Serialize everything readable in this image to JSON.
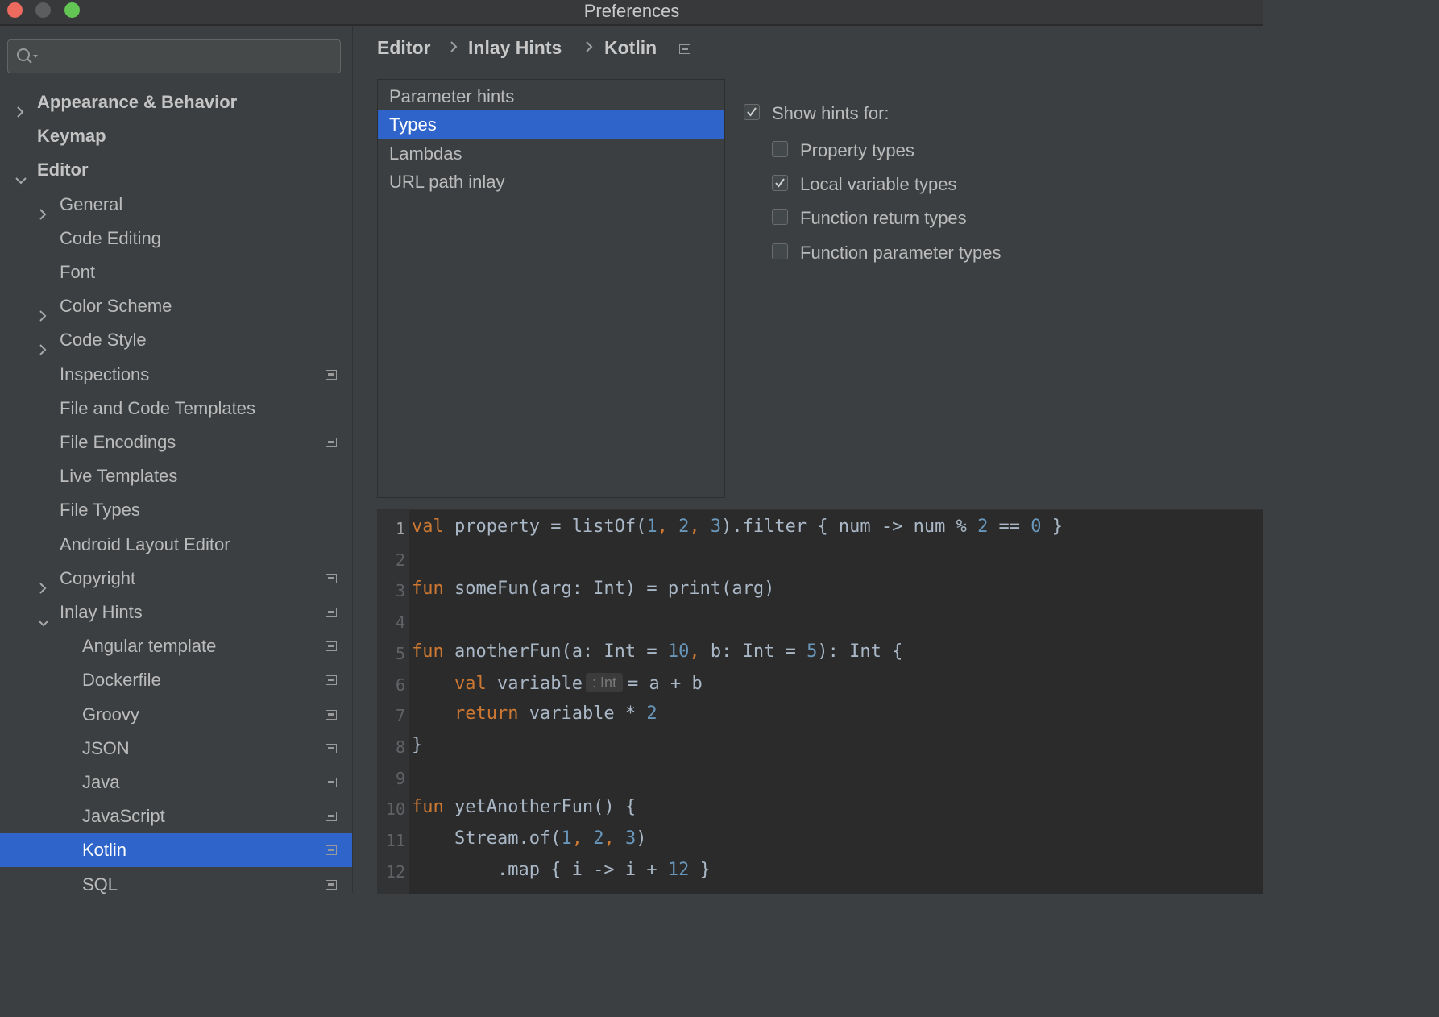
{
  "window": {
    "title": "Preferences"
  },
  "search": {
    "placeholder": "",
    "value": ""
  },
  "sidebar": {
    "items": [
      {
        "label": "Appearance & Behavior",
        "level": 0,
        "bold": true,
        "expander": "collapsed",
        "project_icon": false,
        "selected": false
      },
      {
        "label": "Keymap",
        "level": 0,
        "bold": true,
        "expander": "none",
        "project_icon": false,
        "selected": false
      },
      {
        "label": "Editor",
        "level": 0,
        "bold": true,
        "expander": "expanded",
        "project_icon": false,
        "selected": false
      },
      {
        "label": "General",
        "level": 1,
        "bold": false,
        "expander": "collapsed",
        "project_icon": false,
        "selected": false
      },
      {
        "label": "Code Editing",
        "level": 1,
        "bold": false,
        "expander": "none",
        "project_icon": false,
        "selected": false
      },
      {
        "label": "Font",
        "level": 1,
        "bold": false,
        "expander": "none",
        "project_icon": false,
        "selected": false
      },
      {
        "label": "Color Scheme",
        "level": 1,
        "bold": false,
        "expander": "collapsed",
        "project_icon": false,
        "selected": false
      },
      {
        "label": "Code Style",
        "level": 1,
        "bold": false,
        "expander": "collapsed",
        "project_icon": false,
        "selected": false
      },
      {
        "label": "Inspections",
        "level": 1,
        "bold": false,
        "expander": "none",
        "project_icon": true,
        "selected": false
      },
      {
        "label": "File and Code Templates",
        "level": 1,
        "bold": false,
        "expander": "none",
        "project_icon": false,
        "selected": false
      },
      {
        "label": "File Encodings",
        "level": 1,
        "bold": false,
        "expander": "none",
        "project_icon": true,
        "selected": false
      },
      {
        "label": "Live Templates",
        "level": 1,
        "bold": false,
        "expander": "none",
        "project_icon": false,
        "selected": false
      },
      {
        "label": "File Types",
        "level": 1,
        "bold": false,
        "expander": "none",
        "project_icon": false,
        "selected": false
      },
      {
        "label": "Android Layout Editor",
        "level": 1,
        "bold": false,
        "expander": "none",
        "project_icon": false,
        "selected": false
      },
      {
        "label": "Copyright",
        "level": 1,
        "bold": false,
        "expander": "collapsed",
        "project_icon": true,
        "selected": false
      },
      {
        "label": "Inlay Hints",
        "level": 1,
        "bold": false,
        "expander": "expanded",
        "project_icon": true,
        "selected": false
      },
      {
        "label": "Angular template",
        "level": 2,
        "bold": false,
        "expander": "none",
        "project_icon": true,
        "selected": false
      },
      {
        "label": "Dockerfile",
        "level": 2,
        "bold": false,
        "expander": "none",
        "project_icon": true,
        "selected": false
      },
      {
        "label": "Groovy",
        "level": 2,
        "bold": false,
        "expander": "none",
        "project_icon": true,
        "selected": false
      },
      {
        "label": "JSON",
        "level": 2,
        "bold": false,
        "expander": "none",
        "project_icon": true,
        "selected": false
      },
      {
        "label": "Java",
        "level": 2,
        "bold": false,
        "expander": "none",
        "project_icon": true,
        "selected": false
      },
      {
        "label": "JavaScript",
        "level": 2,
        "bold": false,
        "expander": "none",
        "project_icon": true,
        "selected": false
      },
      {
        "label": "Kotlin",
        "level": 2,
        "bold": false,
        "expander": "none",
        "project_icon": true,
        "selected": true
      },
      {
        "label": "SQL",
        "level": 2,
        "bold": false,
        "expander": "none",
        "project_icon": true,
        "selected": false
      }
    ]
  },
  "breadcrumb": [
    "Editor",
    "Inlay Hints",
    "Kotlin"
  ],
  "hint_categories": {
    "items": [
      "Parameter hints",
      "Types",
      "Lambdas",
      "URL path inlay"
    ],
    "selected_index": 1
  },
  "options": {
    "master": {
      "label": "Show hints for:",
      "checked": true
    },
    "items": [
      {
        "label": "Property types",
        "checked": false
      },
      {
        "label": "Local variable types",
        "checked": true
      },
      {
        "label": "Function return types",
        "checked": false
      },
      {
        "label": "Function parameter types",
        "checked": false
      }
    ]
  },
  "code_preview": {
    "current_line": 1,
    "lines": [
      {
        "n": "1",
        "tokens": [
          [
            "kw",
            "val"
          ],
          [
            "t",
            " property = listOf("
          ],
          [
            "num",
            "1"
          ],
          [
            "kw",
            ", "
          ],
          [
            "num",
            "2"
          ],
          [
            "kw",
            ", "
          ],
          [
            "num",
            "3"
          ],
          [
            "t",
            ").filter { num -> num % "
          ],
          [
            "num",
            "2"
          ],
          [
            "t",
            " == "
          ],
          [
            "num",
            "0"
          ],
          [
            "t",
            " }"
          ]
        ]
      },
      {
        "n": "2",
        "tokens": []
      },
      {
        "n": "3",
        "tokens": [
          [
            "kw",
            "fun"
          ],
          [
            "t",
            " someFun(arg: Int) = print(arg)"
          ]
        ]
      },
      {
        "n": "4",
        "tokens": []
      },
      {
        "n": "5",
        "tokens": [
          [
            "kw",
            "fun"
          ],
          [
            "t",
            " anotherFun(a: Int = "
          ],
          [
            "num",
            "10"
          ],
          [
            "kw",
            ", "
          ],
          [
            "t",
            "b: Int = "
          ],
          [
            "num",
            "5"
          ],
          [
            "t",
            "): Int {"
          ]
        ]
      },
      {
        "n": "6",
        "tokens": [
          [
            "t",
            "    "
          ],
          [
            "kw",
            "val"
          ],
          [
            "t",
            " variable"
          ],
          [
            "hint",
            ": Int"
          ],
          [
            "t",
            "= a + b"
          ]
        ]
      },
      {
        "n": "7",
        "tokens": [
          [
            "t",
            "    "
          ],
          [
            "kw",
            "return"
          ],
          [
            "t",
            " variable * "
          ],
          [
            "num",
            "2"
          ]
        ]
      },
      {
        "n": "8",
        "tokens": [
          [
            "t",
            "}"
          ]
        ]
      },
      {
        "n": "9",
        "tokens": []
      },
      {
        "n": "10",
        "tokens": [
          [
            "kw",
            "fun"
          ],
          [
            "t",
            " yetAnotherFun() {"
          ]
        ]
      },
      {
        "n": "11",
        "tokens": [
          [
            "t",
            "    Stream.of("
          ],
          [
            "num",
            "1"
          ],
          [
            "kw",
            ", "
          ],
          [
            "num",
            "2"
          ],
          [
            "kw",
            ", "
          ],
          [
            "num",
            "3"
          ],
          [
            "t",
            ")"
          ]
        ]
      },
      {
        "n": "12",
        "tokens": [
          [
            "t",
            "        .map { i -> i + "
          ],
          [
            "num",
            "12"
          ],
          [
            "t",
            " }"
          ]
        ]
      }
    ]
  },
  "colors": {
    "accent": "#2f65ca",
    "keyword": "#cc7832",
    "number": "#6897bb",
    "text": "#a9b7c6",
    "editor_bg": "#2b2b2b"
  },
  "icons": {
    "search": "search-icon",
    "tree_expander": "chevron-icon",
    "project_level": "project-level-icon",
    "checkbox": "check-icon"
  }
}
